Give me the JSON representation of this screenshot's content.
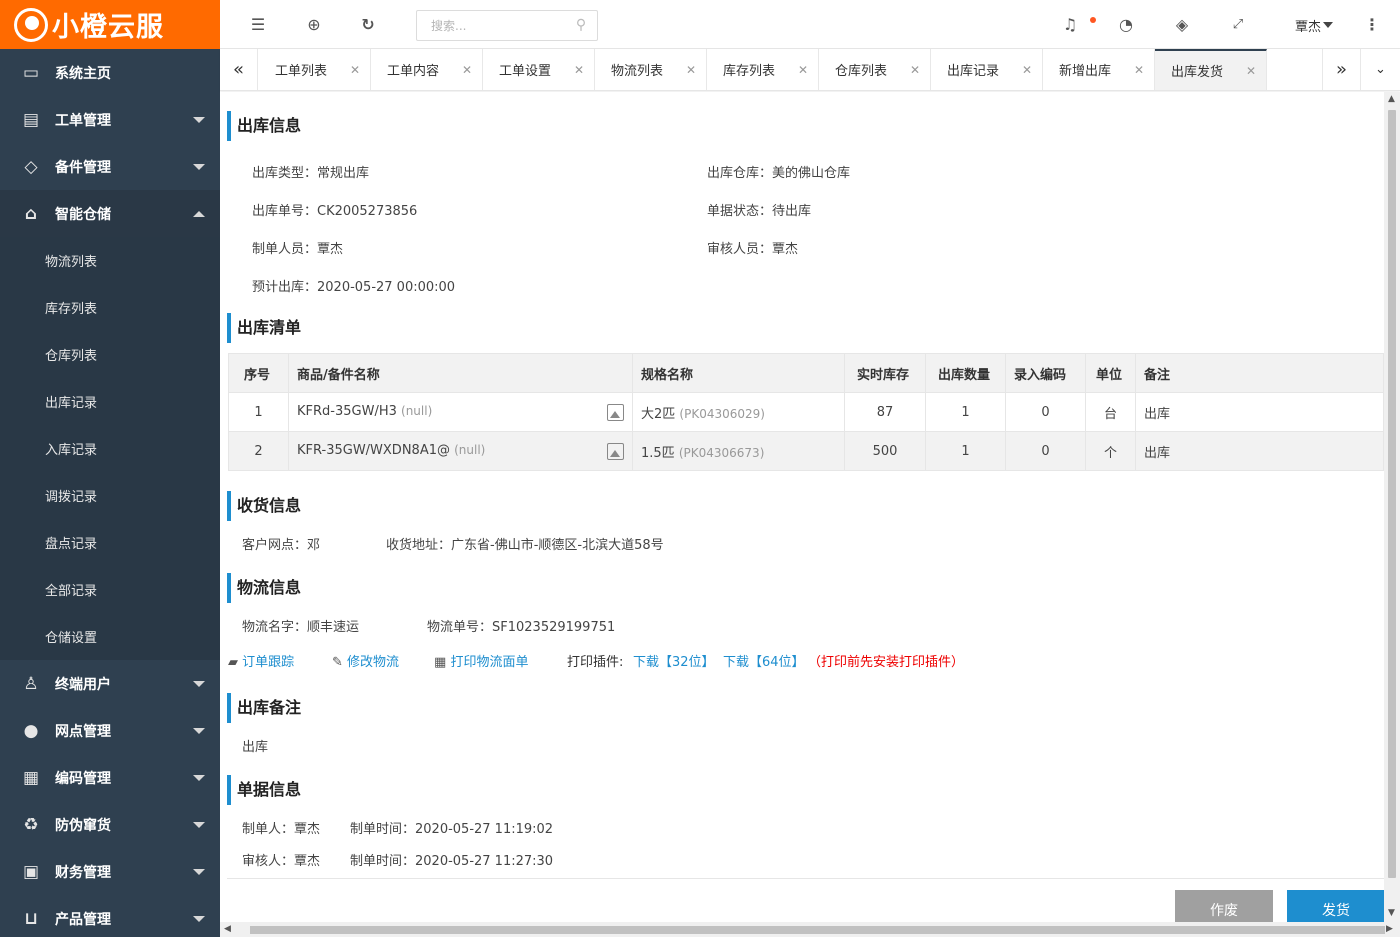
{
  "brand": {
    "name": "小橙云服",
    "color": "#ff6a00"
  },
  "sidebar": {
    "items": [
      {
        "label": "系统主页",
        "icon": "monitor-icon",
        "expandable": false
      },
      {
        "label": "工单管理",
        "icon": "document-icon",
        "expandable": true
      },
      {
        "label": "备件管理",
        "icon": "code-icon",
        "expandable": true
      },
      {
        "label": "智能仓储",
        "icon": "bank-icon",
        "expandable": true,
        "open": true
      }
    ],
    "subitems": [
      "物流列表",
      "库存列表",
      "仓库列表",
      "出库记录",
      "入库记录",
      "调拨记录",
      "盘点记录",
      "全部记录",
      "仓储设置"
    ],
    "items_after": [
      {
        "label": "终端用户",
        "icon": "user-icon",
        "expandable": true
      },
      {
        "label": "网点管理",
        "icon": "globe-icon",
        "expandable": true
      },
      {
        "label": "编码管理",
        "icon": "grid-icon",
        "expandable": true
      },
      {
        "label": "防伪窜货",
        "icon": "recycle-icon",
        "expandable": true
      },
      {
        "label": "财务管理",
        "icon": "money-icon",
        "expandable": true
      },
      {
        "label": "产品管理",
        "icon": "cart-icon",
        "expandable": true
      }
    ]
  },
  "topbar": {
    "search_placeholder": "搜索...",
    "user": "覃杰"
  },
  "tabs": [
    "工单列表",
    "工单内容",
    "工单设置",
    "物流列表",
    "库存列表",
    "仓库列表",
    "出库记录",
    "新增出库",
    "出库发货"
  ],
  "active_tab": "出库发货",
  "outbound_info": {
    "title": "出库信息",
    "type": "出库类型：常规出库",
    "warehouse": "出库仓库：美的佛山仓库",
    "number": "出库单号：CK2005273856",
    "status": "单据状态：待出库",
    "creator": "制单人员：覃杰",
    "reviewer": "审核人员：覃杰",
    "planned": "预计出库：2020-05-27 00:00:00"
  },
  "list": {
    "title": "出库清单",
    "headers": [
      "序号",
      "商品/备件名称",
      "规格名称",
      "实时库存",
      "出库数量",
      "录入编码",
      "单位",
      "备注"
    ],
    "rows": [
      {
        "no": "1",
        "name": "KFRd-35GW/H3",
        "name_note": "(null)",
        "spec": "大2匹",
        "spec_code": "(PK04306029)",
        "stock": "87",
        "qty": "1",
        "code": "0",
        "unit": "台",
        "remark": "出库"
      },
      {
        "no": "2",
        "name": "KFR-35GW/WXDN8A1@",
        "name_note": "(null)",
        "spec": "1.5匹",
        "spec_code": "(PK04306673)",
        "stock": "500",
        "qty": "1",
        "code": "0",
        "unit": "个",
        "remark": "出库"
      }
    ]
  },
  "receive": {
    "title": "收货信息",
    "site": "客户网点：邓",
    "address": "收货地址：广东省-佛山市-顺德区-北滨大道58号"
  },
  "logistics": {
    "title": "物流信息",
    "name": "物流名字：顺丰速运",
    "number": "物流单号：SF1023529199751",
    "track": "订单跟踪",
    "edit": "修改物流",
    "print": "打印物流面单",
    "plugin_label": "打印插件:",
    "dl32": "下载【32位】",
    "dl64": "下载【64位】",
    "warn": "（打印前先安装打印插件）"
  },
  "remark": {
    "title": "出库备注",
    "text": "出库"
  },
  "doc": {
    "title": "单据信息",
    "creator": "制单人：覃杰",
    "create_time": "制单时间：2020-05-27 11:19:02",
    "reviewer": "审核人：覃杰",
    "review_time": "制单时间：2020-05-27 11:27:30"
  },
  "buttons": {
    "void": "作废",
    "ship": "发货",
    "void_color": "#a0a0a0",
    "ship_color": "#1e8ecf"
  }
}
